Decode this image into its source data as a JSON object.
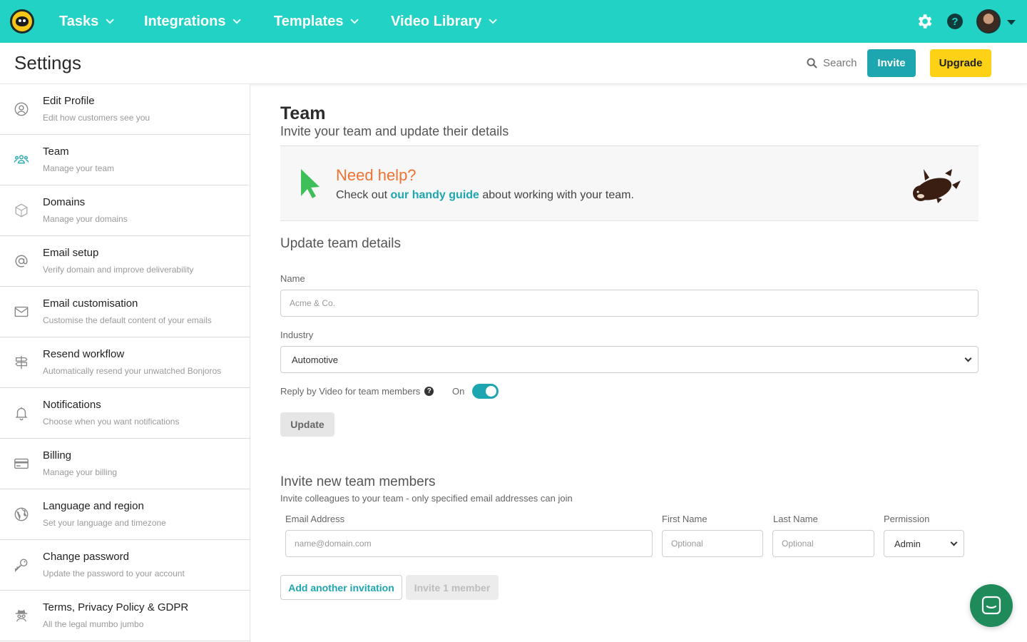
{
  "topnav": {
    "items": [
      {
        "label": "Tasks"
      },
      {
        "label": "Integrations"
      },
      {
        "label": "Templates"
      },
      {
        "label": "Video Library"
      }
    ],
    "help_glyph": "?"
  },
  "header": {
    "title": "Settings",
    "search_label": "Search",
    "invite_label": "Invite",
    "upgrade_label": "Upgrade"
  },
  "sidebar": {
    "items": [
      {
        "title": "Edit Profile",
        "subtitle": "Edit how customers see you",
        "icon": "user-circle-icon"
      },
      {
        "title": "Team",
        "subtitle": "Manage your team",
        "icon": "team-icon"
      },
      {
        "title": "Domains",
        "subtitle": "Manage your domains",
        "icon": "globe-icon"
      },
      {
        "title": "Email setup",
        "subtitle": "Verify domain and improve deliverability",
        "icon": "at-sign-icon"
      },
      {
        "title": "Email customisation",
        "subtitle": "Customise the default content of your emails",
        "icon": "envelope-icon"
      },
      {
        "title": "Resend workflow",
        "subtitle": "Automatically resend your unwatched Bonjoros",
        "icon": "signpost-icon"
      },
      {
        "title": "Notifications",
        "subtitle": "Choose when you want notifications",
        "icon": "bell-icon"
      },
      {
        "title": "Billing",
        "subtitle": "Manage your billing",
        "icon": "credit-card-icon"
      },
      {
        "title": "Language and region",
        "subtitle": "Set your language and timezone",
        "icon": "earth-icon"
      },
      {
        "title": "Change password",
        "subtitle": "Update the password to your account",
        "icon": "key-icon"
      },
      {
        "title": "Terms, Privacy Policy & GDPR",
        "subtitle": "All the legal mumbo jumbo",
        "icon": "spy-icon"
      }
    ],
    "active_item": "Team"
  },
  "main": {
    "title": "Team",
    "subtitle": "Invite your team and update their details",
    "help": {
      "title": "Need help?",
      "text_before": "Check out ",
      "link": "our handy guide",
      "text_after": " about working with your team."
    },
    "update_section": {
      "title": "Update team details",
      "name_label": "Name",
      "name_placeholder": "Acme & Co.",
      "industry_label": "Industry",
      "industry_value": "Automotive",
      "reply_label": "Reply by Video for team members",
      "reply_help_glyph": "?",
      "toggle_state": "On",
      "update_button": "Update"
    },
    "invite_section": {
      "title": "Invite new team members",
      "subtitle": "Invite colleagues to your team - only specified email addresses can join",
      "email_label": "Email Address",
      "email_placeholder": "name@domain.com",
      "first_name_label": "First Name",
      "first_name_placeholder": "Optional",
      "last_name_label": "Last Name",
      "last_name_placeholder": "Optional",
      "permission_label": "Permission",
      "permission_value": "Admin",
      "add_button": "Add another invitation",
      "invite_button": "Invite 1 member"
    }
  },
  "colors": {
    "nav_bg": "#22d3c5",
    "accent_teal": "#1ea6b0",
    "upgrade_yellow": "#fcd116",
    "help_orange": "#f07230",
    "chat_green": "#1f8a5a"
  }
}
